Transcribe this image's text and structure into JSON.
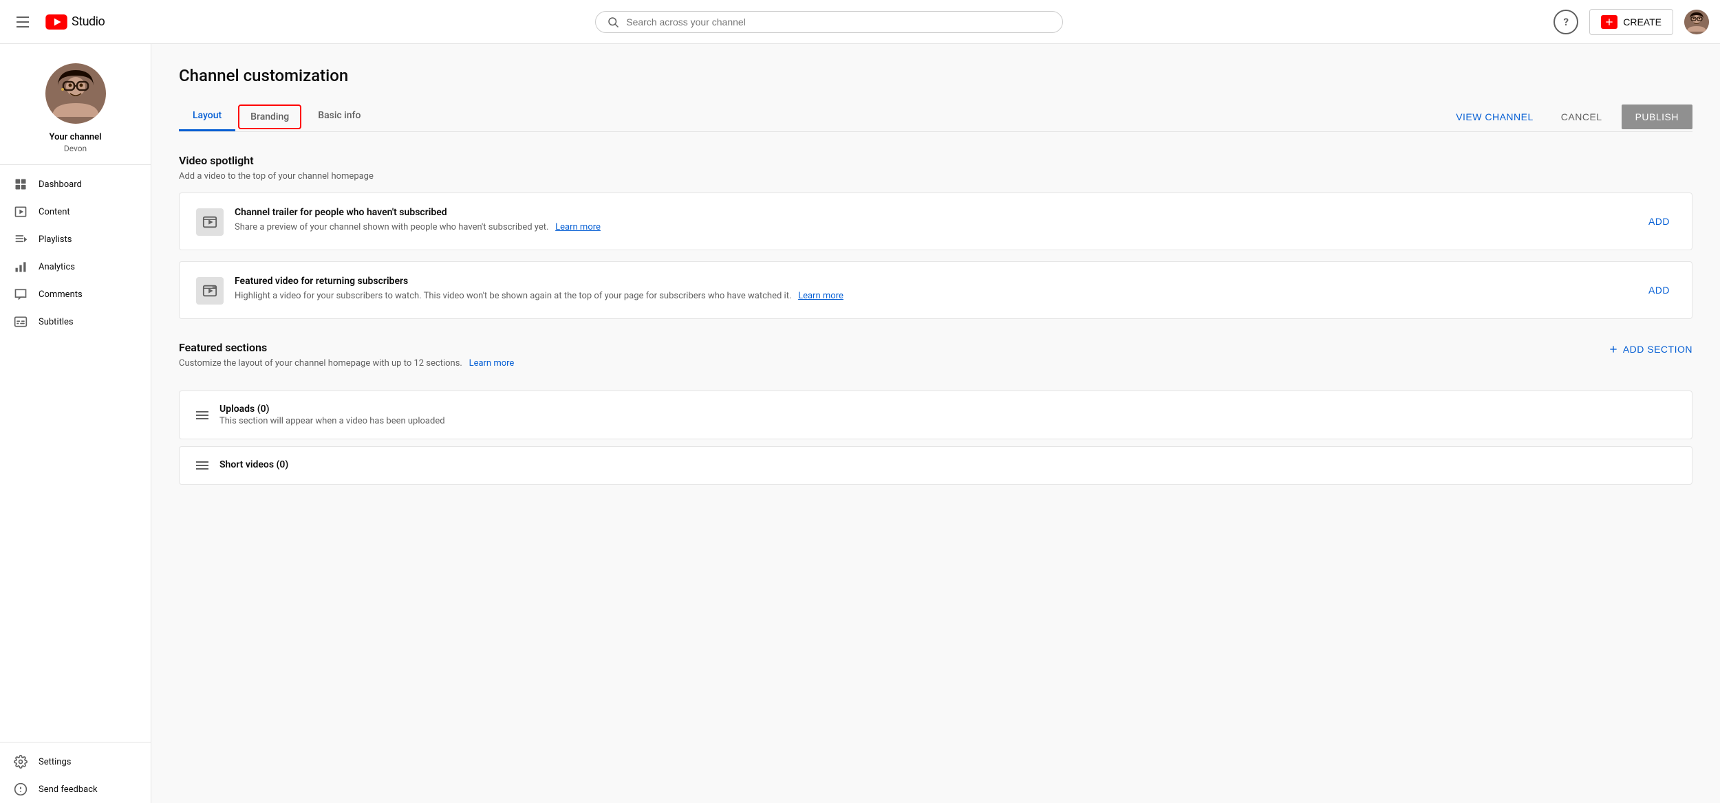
{
  "header": {
    "menu_icon": "hamburger-icon",
    "logo_text": "Studio",
    "search_placeholder": "Search across your channel",
    "help_label": "?",
    "create_label": "CREATE",
    "avatar_alt": "User avatar"
  },
  "sidebar": {
    "channel_name": "Your channel",
    "channel_handle": "Devon",
    "nav_items": [
      {
        "id": "dashboard",
        "label": "Dashboard",
        "icon": "dashboard-icon"
      },
      {
        "id": "content",
        "label": "Content",
        "icon": "content-icon"
      },
      {
        "id": "playlists",
        "label": "Playlists",
        "icon": "playlists-icon"
      },
      {
        "id": "analytics",
        "label": "Analytics",
        "icon": "analytics-icon"
      },
      {
        "id": "comments",
        "label": "Comments",
        "icon": "comments-icon"
      },
      {
        "id": "subtitles",
        "label": "Subtitles",
        "icon": "subtitles-icon"
      }
    ],
    "nav_bottom_items": [
      {
        "id": "settings",
        "label": "Settings",
        "icon": "settings-icon"
      },
      {
        "id": "send-feedback",
        "label": "Send feedback",
        "icon": "feedback-icon"
      }
    ]
  },
  "page": {
    "title": "Channel customization",
    "tabs": [
      {
        "id": "layout",
        "label": "Layout",
        "active": true
      },
      {
        "id": "branding",
        "label": "Branding",
        "highlighted": true
      },
      {
        "id": "basic-info",
        "label": "Basic info"
      }
    ],
    "view_channel_label": "VIEW CHANNEL",
    "cancel_label": "CANCEL",
    "publish_label": "PUBLISH"
  },
  "video_spotlight": {
    "title": "Video spotlight",
    "description": "Add a video to the top of your channel homepage",
    "cards": [
      {
        "id": "channel-trailer",
        "title": "Channel trailer for people who haven't subscribed",
        "description": "Share a preview of your channel shown with people who haven't subscribed yet.",
        "learn_more_label": "Learn more",
        "action_label": "ADD"
      },
      {
        "id": "featured-video",
        "title": "Featured video for returning subscribers",
        "description": "Highlight a video for your subscribers to watch. This video won't be shown again at the top of your page for subscribers who have watched it.",
        "learn_more_label": "Learn more",
        "action_label": "ADD"
      }
    ]
  },
  "featured_sections": {
    "title": "Featured sections",
    "description": "Customize the layout of your channel homepage with up to 12 sections.",
    "learn_more_label": "Learn more",
    "add_section_label": "ADD SECTION",
    "sections": [
      {
        "id": "uploads",
        "title": "Uploads (0)",
        "description": "This section will appear when a video has been uploaded"
      },
      {
        "id": "short-videos",
        "title": "Short videos (0)",
        "description": ""
      }
    ]
  }
}
